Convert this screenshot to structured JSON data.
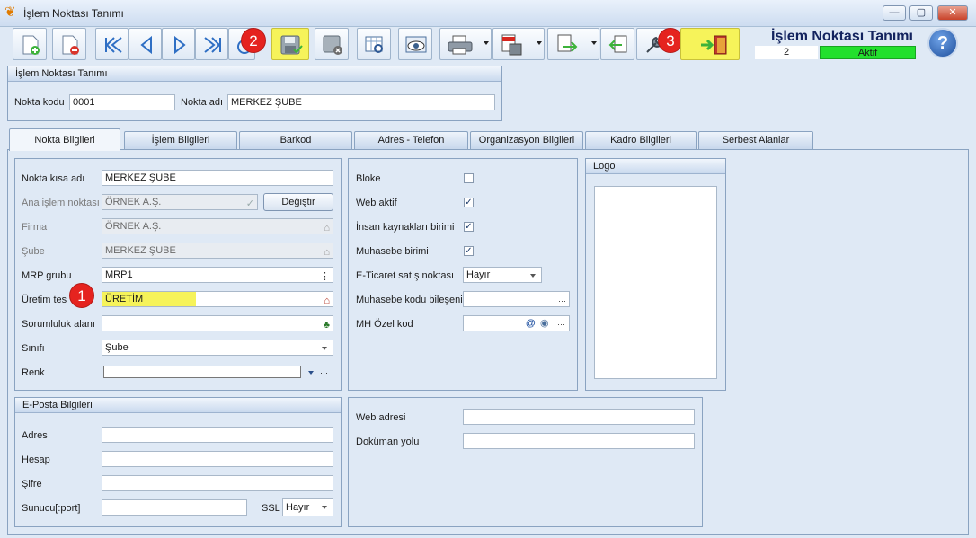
{
  "window": {
    "title": "İşlem Noktası Tanımı",
    "heading": "İşlem Noktası Tanımı",
    "record_count": "2",
    "status": "Aktif",
    "controls": {
      "minimize": "—",
      "maximize": "▢",
      "close": "✕"
    },
    "help": "?"
  },
  "annotations": {
    "one": "1",
    "two": "2",
    "three": "3"
  },
  "header": {
    "group_title": "İşlem Noktası Tanımı",
    "code_label": "Nokta kodu",
    "code_value": "0001",
    "name_label": "Nokta adı",
    "name_value": "MERKEZ ŞUBE"
  },
  "tabs": [
    "Nokta Bilgileri",
    "İşlem Bilgileri",
    "Barkod",
    "Adres - Telefon",
    "Organizasyon Bilgileri",
    "Kadro Bilgileri",
    "Serbest Alanlar"
  ],
  "left_form": {
    "short_name_label": "Nokta kısa adı",
    "short_name_value": "MERKEZ ŞUBE",
    "main_point_label": "Ana işlem noktası",
    "main_point_value": "ÖRNEK A.Ş.",
    "change_button": "Değiştir",
    "firm_label": "Firma",
    "firm_value": "ÖRNEK A.Ş.",
    "branch_label": "Şube",
    "branch_value": "MERKEZ ŞUBE",
    "mrp_label": "MRP grubu",
    "mrp_value": "MRP1",
    "plant_label": "Üretim tes",
    "plant_value": "ÜRETİM",
    "responsibility_label": "Sorumluluk alanı",
    "responsibility_value": "",
    "class_label": "Sınıfı",
    "class_value": "Şube",
    "color_label": "Renk",
    "color_value": ""
  },
  "mid_form": {
    "block_label": "Bloke",
    "web_active_label": "Web aktif",
    "hr_unit_label": "İnsan kaynakları birimi",
    "accounting_unit_label": "Muhasebe birimi",
    "ecommerce_label": "E-Ticaret satış noktası",
    "ecommerce_value": "Hayır",
    "accounting_code_label": "Muhasebe kodu bileşeni",
    "accounting_code_value": "",
    "mh_code_label": "MH Özel kod",
    "mh_code_value": ""
  },
  "checks": {
    "block": false,
    "web_active": true,
    "hr_unit": true,
    "accounting_unit": true,
    "mark": "✓"
  },
  "logo": {
    "title": "Logo"
  },
  "email": {
    "title": "E-Posta Bilgileri",
    "address_label": "Adres",
    "account_label": "Hesap",
    "password_label": "Şifre",
    "server_label": "Sunucu[:port]",
    "ssl_label": "SSL",
    "ssl_value": "Hayır"
  },
  "web": {
    "web_address_label": "Web adresi",
    "doc_path_label": "Doküman yolu"
  },
  "icons": {
    "ellipsis": "···",
    "at": "@"
  },
  "colors": {
    "highlight": "#f6f35a",
    "status_green": "#22e02d",
    "badge_red": "#e5231f",
    "accent_navy": "#13235e"
  }
}
